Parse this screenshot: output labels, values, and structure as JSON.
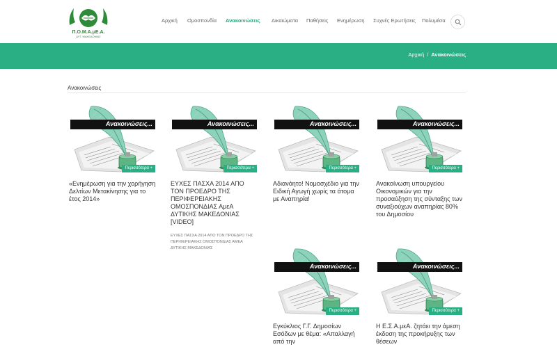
{
  "header": {
    "logo_text": "Π.Ο.Μ.Α.μΕ.Α.",
    "logo_sub": "ΔΥΤ. ΜΑΚΕΔΟΝΙΑΣ",
    "nav": [
      "Αρχική",
      "Ομοσπονδία",
      "Ανακοινώσεις",
      "Δικαιώματα",
      "Παθήσεις",
      "Ενημέρωση",
      "Συχνές Ερωτήσεις",
      "Πολυμέσα"
    ],
    "active": "Ανακοινώσεις"
  },
  "breadcrumb": {
    "home": "Αρχική",
    "sep": "/",
    "current": "Ανακοινώσεις"
  },
  "section": {
    "title": "Ανακοινώσεις"
  },
  "colors": {
    "accent": "#2aae84",
    "bar": "#111111",
    "quill": "#6fc3a8"
  },
  "cards": [
    {
      "category": "Ανακοινώσεις...",
      "more": "Περισσότερα +",
      "title": "«Ενημέρωση για την χορήγηση Δελτίων Μετακίνησης για το έτος 2014»",
      "excerpt": ""
    },
    {
      "category": "Ανακοινώσεις...",
      "more": "Περισσότερα +",
      "title": "ΕΥΧΕΣ ΠΑΣΧΑ 2014 ΑΠΟ ΤΟΝ ΠΡΟΕΔΡΟ ΤΗΣ ΠΕΡΙΦΕΡΕΙΑΚΗΣ ΟΜΟΣΠΟΝΔΙΑΣ ΑμεΑ ΔΥΤΙΚΗΣ ΜΑΚΕΔΟΝΙΑΣ [VIDEO]",
      "excerpt": "ΕΥΧΕΣ ΠΑΣΧΑ 2014 ΑΠΟ ΤΟΝ ΠΡΟΕΔΡΟ ΤΗΣ ΠΕΡΙΦΕΡΕΙΑΚΗΣ ΟΜΟΣΠΟΝΔΙΑΣ ΑμεΑ ΔΥΤΙΚΗΣ ΜΑΚΕΔΟΝΙΑΣ"
    },
    {
      "category": "Ανακοινώσεις...",
      "more": "Περισσότερα +",
      "title": "Αδιανόητο! Νομοσχέδιο για την Ειδική Αγωγή χωρίς τα άτομα με Αναπηρία!",
      "excerpt": ""
    },
    {
      "category": "Ανακοινώσεις...",
      "more": "Περισσότερα +",
      "title": "Ανακοίνωση υπουργείου Οικονομικών για την προσαύξηση της σύνταξης των συναξιούχων αναπηρίας 80% του Δημοσίου",
      "excerpt": ""
    },
    {
      "category": "Ανακοινώσεις...",
      "more": "Περισσότερα +",
      "title": "Εγκύκλιος Γ.Γ. Δημοσίων Εσόδων με θέμα: «Απαλλαγή από την",
      "excerpt": ""
    },
    {
      "category": "Ανακοινώσεις...",
      "more": "Περισσότερα +",
      "title": "Η Ε.Σ.Α.μεΑ. ζητάει την άμεση έκδοση της προκήρυξης των θέσεων",
      "excerpt": ""
    }
  ]
}
